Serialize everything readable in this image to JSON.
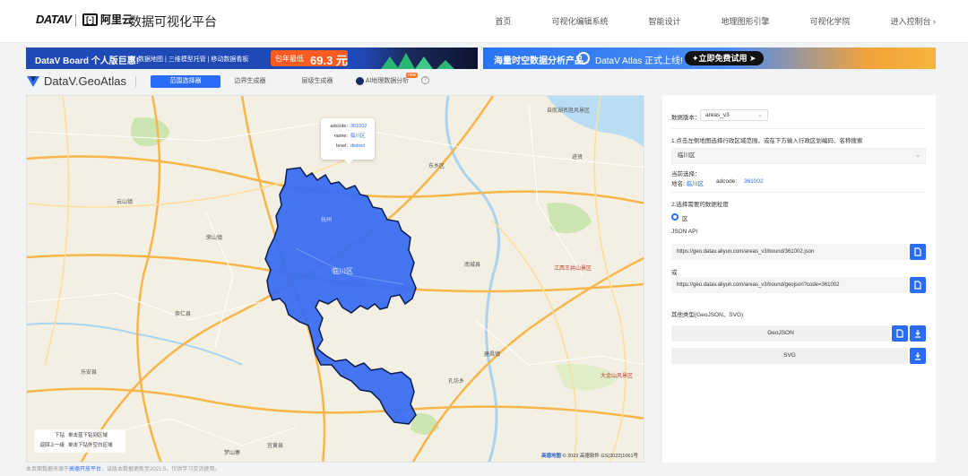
{
  "header": {
    "logo_datav": "DATAV",
    "logo_aliyun": "阿里云",
    "logo_aliyun_bracket": "[-]",
    "site_title": "数据可视化平台",
    "nav": [
      "首页",
      "可视化编辑系统",
      "智能设计",
      "地理图形引擎",
      "可视化学院",
      "进入控制台 ›"
    ]
  },
  "banner_left": {
    "title": "DataV Board 个人版巨惠!",
    "subtitle": "数据地图 | 三维模型托管 | 移动数据看板",
    "price_label": "包年最低",
    "price_value": "69.3 元"
  },
  "banner_right": {
    "text": "海量时空数据分析产品",
    "brand": "DataV Atlas  正式上线!",
    "cta": "✦立即免费试用 ➤"
  },
  "toolbar": {
    "brand": "DataV.GeoAtlas",
    "tabs": [
      "范围选择器",
      "边界生成器",
      "层级生成器",
      "AI地理数据分析"
    ],
    "new_badge": "new",
    "help": "?"
  },
  "map": {
    "tooltip": {
      "adcode_key": "adcode:",
      "adcode_val": "361002",
      "name_key": "name:",
      "name_val": "临川区",
      "level_key": "level:",
      "level_val": "district"
    },
    "help": {
      "down_key": "下钻",
      "down_val": "单击蓝下钻到区域",
      "up_key": "返回上一级",
      "up_val": "单击下钻外空白区域"
    },
    "attribution_brand": "高德地图",
    "attribution": "© 2022 高德软件 GS(2022)1061号",
    "place_labels": [
      "自航湖名胜风景区",
      "进贤",
      "东乡区",
      "临川区",
      "江西王井山景区",
      "大金山风景区",
      "崇仁县",
      "宜黄县",
      "南城县",
      "建昌镇",
      "乐安县",
      "梦山寨",
      "抚州",
      "云山镇",
      "荣山镇",
      "孔坊乡"
    ],
    "colors": {
      "region_fill": "#3a6df0",
      "region_stroke": "#0b1d4f",
      "road_major": "#f7b54a",
      "road_minor": "#ffffff",
      "water": "#a8d4f2",
      "green": "#cde5b0",
      "background": "#f3efe2"
    }
  },
  "footnote": {
    "text_before": "本页面数据来源于",
    "link": "高德开放平台",
    "text_after": "，该版本数据更新至2021.5，仅供学习交流使用。"
  },
  "panel": {
    "version_label": "数据版本：",
    "version_value": "areas_v3",
    "step1": "1.点击左侧地图选择行政区域范围，或在下方输入行政区划编码、名称搜索",
    "search_value": "临川区",
    "current_label": "当前选择：",
    "current_name_key": "地名:",
    "current_name_val": "临川区",
    "current_adcode_key": "adcode:",
    "current_adcode_val": "361002",
    "step2": "2.选择需要的数据粒度",
    "granularity": "区",
    "json_api_label": "JSON API",
    "json_api_url": "https://geo.datav.aliyun.com/areas_v3/bound/361002.json",
    "or_label": "或",
    "geojson_url": "https://geo.datav.aliyun.com/areas_v3/bound/geojson?code=361002",
    "other_types_label": "其他类型(GeoJSON、SVG)",
    "geojson_button": "GeoJSON",
    "svg_button": "SVG",
    "accent": "#2a6cf6"
  }
}
